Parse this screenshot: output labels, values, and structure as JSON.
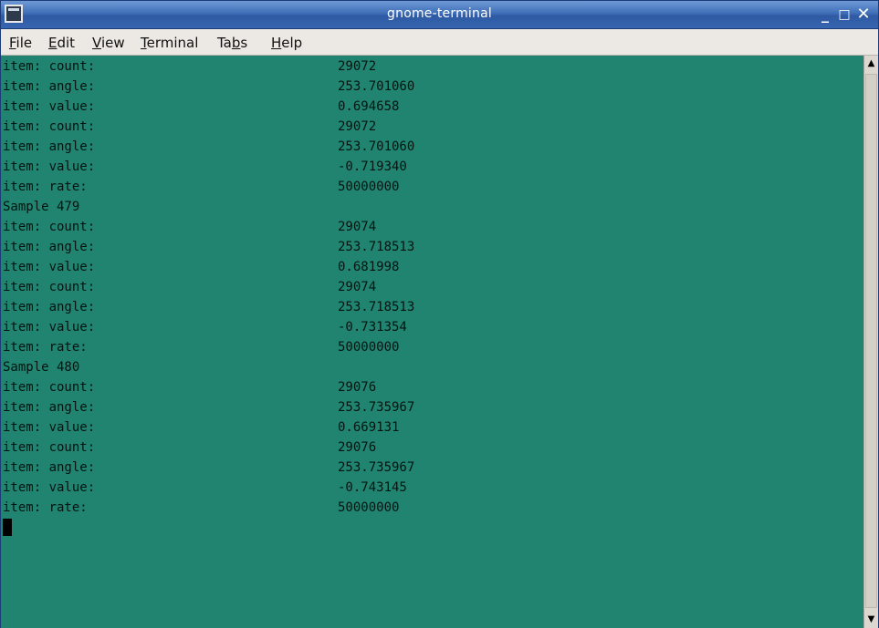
{
  "window": {
    "title": "gnome-terminal",
    "controls": {
      "minimize": "_",
      "maximize": "□",
      "close": "✕"
    }
  },
  "menu": [
    {
      "mnemonic": "F",
      "rest": "ile"
    },
    {
      "mnemonic": "E",
      "rest": "dit"
    },
    {
      "mnemonic": "V",
      "rest": "iew"
    },
    {
      "mnemonic": "T",
      "rest": "erminal"
    },
    {
      "pre": "Ta",
      "mnemonic": "b",
      "rest": "s"
    },
    {
      "mnemonic": "H",
      "rest": "elp"
    }
  ],
  "terminal": {
    "background": "#218471",
    "lines": [
      {
        "label": "item: count:",
        "value": "29072"
      },
      {
        "label": "item: angle:",
        "value": "253.701060"
      },
      {
        "label": "item: value:",
        "value": "0.694658"
      },
      {
        "label": "item: count:",
        "value": "29072"
      },
      {
        "label": "item: angle:",
        "value": "253.701060"
      },
      {
        "label": "item: value:",
        "value": "-0.719340"
      },
      {
        "label": "item: rate:",
        "value": "50000000"
      },
      {
        "label": "Sample 479",
        "value": ""
      },
      {
        "label": "item: count:",
        "value": "29074"
      },
      {
        "label": "item: angle:",
        "value": "253.718513"
      },
      {
        "label": "item: value:",
        "value": "0.681998"
      },
      {
        "label": "item: count:",
        "value": "29074"
      },
      {
        "label": "item: angle:",
        "value": "253.718513"
      },
      {
        "label": "item: value:",
        "value": "-0.731354"
      },
      {
        "label": "item: rate:",
        "value": "50000000"
      },
      {
        "label": "Sample 480",
        "value": ""
      },
      {
        "label": "item: count:",
        "value": "29076"
      },
      {
        "label": "item: angle:",
        "value": "253.735967"
      },
      {
        "label": "item: value:",
        "value": "0.669131"
      },
      {
        "label": "item: count:",
        "value": "29076"
      },
      {
        "label": "item: angle:",
        "value": "253.735967"
      },
      {
        "label": "item: value:",
        "value": "-0.743145"
      },
      {
        "label": "item: rate:",
        "value": "50000000"
      }
    ]
  },
  "scrollbar": {
    "up_icon": "scroll-up-arrow",
    "down_icon": "scroll-down-arrow"
  }
}
